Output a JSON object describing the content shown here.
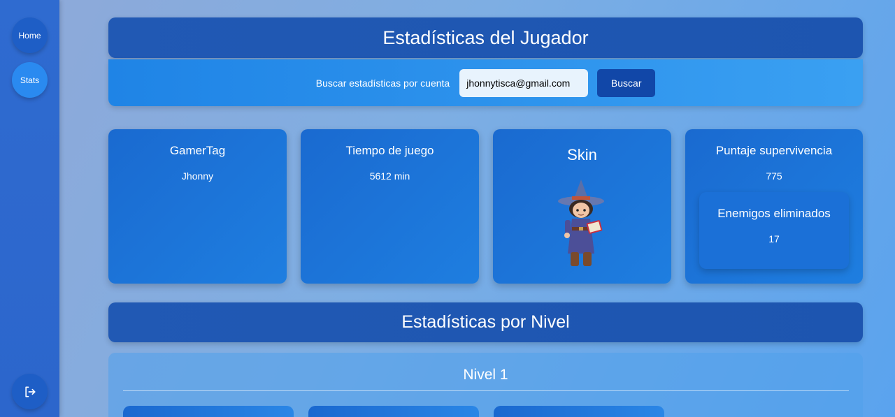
{
  "sidebar": {
    "home_label": "Home",
    "stats_label": "Stats",
    "logout_icon": "logout-icon"
  },
  "header": {
    "title": "Estadísticas del Jugador"
  },
  "search": {
    "label": "Buscar estadísticas por cuenta",
    "value": "jhonnytisca@gmail.com",
    "button_label": "Buscar"
  },
  "cards": {
    "gamertag": {
      "title": "GamerTag",
      "value": "Jhonny"
    },
    "playtime": {
      "title": "Tiempo de juego",
      "value": "5612 min"
    },
    "skin": {
      "title": "Skin",
      "image": "wizard-character"
    },
    "survival": {
      "title": "Puntaje supervivencia",
      "value": "775"
    },
    "enemies": {
      "title": "Enemigos eliminados",
      "value": "17"
    }
  },
  "levels": {
    "section_title": "Estadísticas por Nivel",
    "items": [
      {
        "title": "Nivel 1"
      }
    ]
  },
  "colors": {
    "sidebar": "#2f6bd0",
    "header": "#2159b4",
    "search_bar": "#1f84e6",
    "card": "#1a6ad0",
    "button": "#1147a8"
  }
}
